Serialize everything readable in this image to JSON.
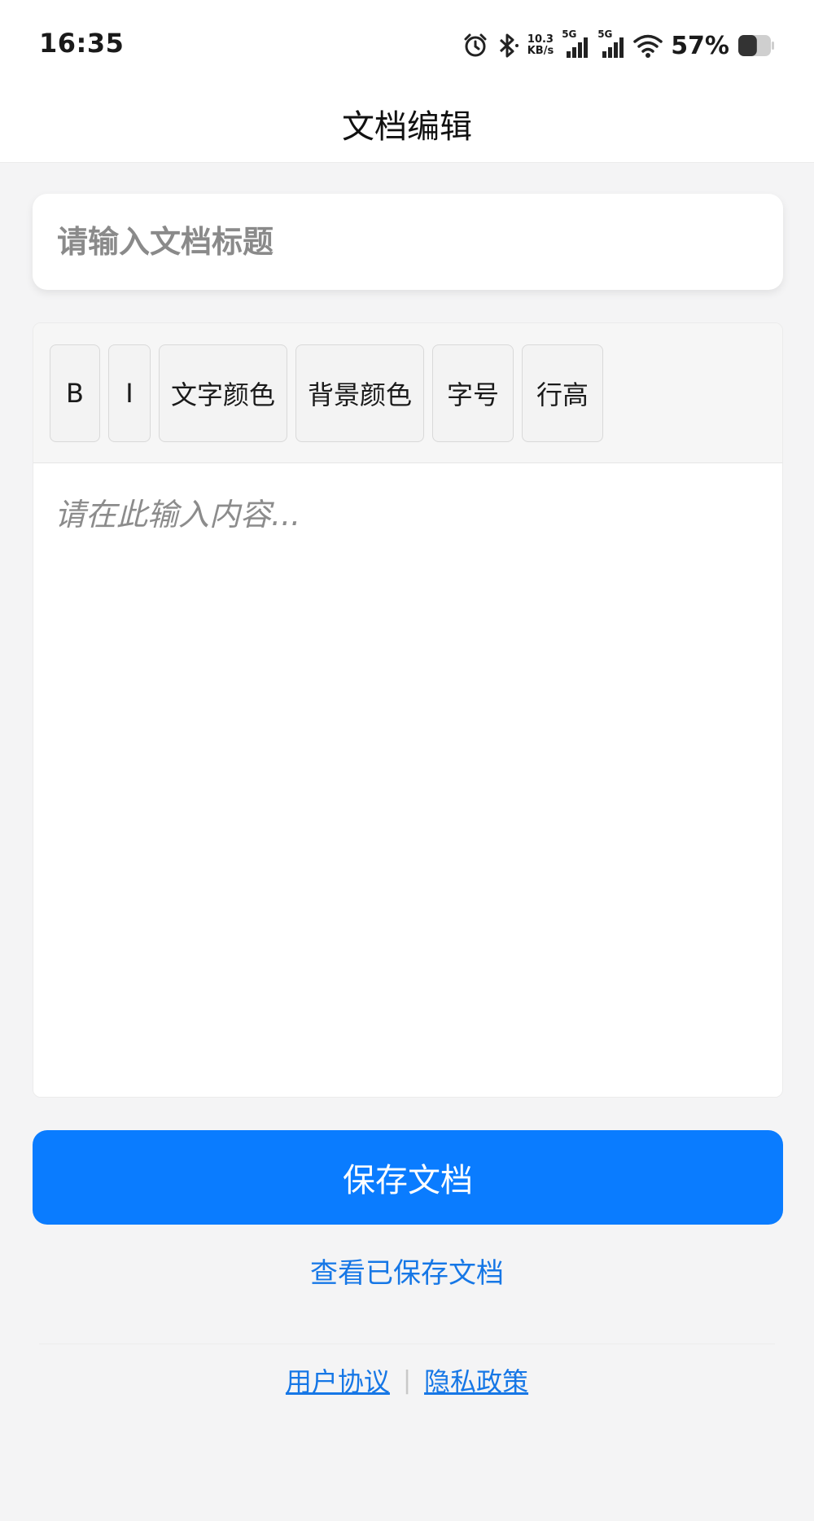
{
  "status_bar": {
    "time": "16:35",
    "net_speed_value": "10.3",
    "net_speed_unit": "KB/s",
    "sim1_label": "5G",
    "sim2_label": "5G",
    "battery_percent": "57%",
    "battery_level": 0.57,
    "icons": [
      "alarm-icon",
      "bluetooth-icon",
      "signal-icon",
      "wifi-icon",
      "battery-icon"
    ]
  },
  "header": {
    "title": "文档编辑"
  },
  "title_input": {
    "placeholder": "请输入文档标题",
    "value": ""
  },
  "toolbar": {
    "buttons": [
      {
        "label": "B"
      },
      {
        "label": "I"
      },
      {
        "label": "文字颜色"
      },
      {
        "label": "背景颜色"
      },
      {
        "label": "字号"
      },
      {
        "label": "行高"
      }
    ]
  },
  "editor": {
    "placeholder": "请在此输入内容...",
    "value": ""
  },
  "actions": {
    "save_label": "保存文档",
    "view_saved_label": "查看已保存文档"
  },
  "footer": {
    "user_agreement": "用户协议",
    "separator": "|",
    "privacy_policy": "隐私政策"
  },
  "colors": {
    "primary": "#0a7cff",
    "link": "#1677e6",
    "background": "#f4f4f5"
  }
}
